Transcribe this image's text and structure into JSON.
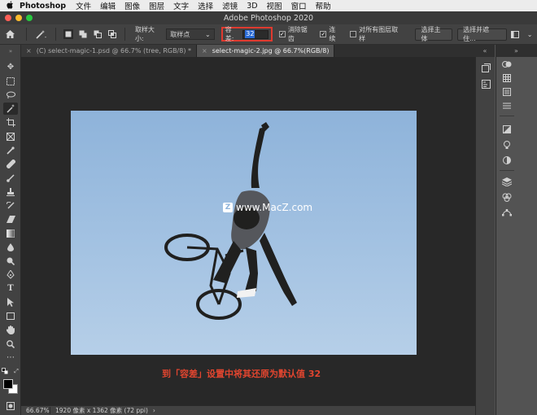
{
  "menubar": {
    "apple": "",
    "app": "Photoshop",
    "items": [
      "文件",
      "编辑",
      "图像",
      "图层",
      "文字",
      "选择",
      "滤镜",
      "3D",
      "视图",
      "窗口",
      "帮助"
    ]
  },
  "window": {
    "title": "Adobe Photoshop 2020"
  },
  "options": {
    "sample_size_label": "取样大小:",
    "sample_size_value": "取样点",
    "tolerance_label": "容差:",
    "tolerance_value": "32",
    "antialias_label": "消除锯齿",
    "contiguous_label": "连续",
    "all_layers_label": "对所有图层取样",
    "select_subject": "选择主体",
    "select_mask": "选择并遮住..."
  },
  "tabs": [
    {
      "label": "(C) select-magic-1.psd @ 66.7% (tree, RGB/8) *",
      "close": "×",
      "active": false
    },
    {
      "label": "select-magic-2.jpg @ 66.7%(RGB/8)",
      "close": "×",
      "active": true
    }
  ],
  "canvas": {
    "watermark": "www.MacZ.com",
    "watermark_logo": "Z",
    "caption": "到「容差」设置中将其还原为默认值 32"
  },
  "status": {
    "zoom": "66.67%",
    "info": "1920 像素 x 1362 像素 (72 ppi)"
  },
  "colors": {
    "accent_highlight": "#e03a2f",
    "selection_blue": "#2a6bd6",
    "caption_color": "#e1452f"
  }
}
